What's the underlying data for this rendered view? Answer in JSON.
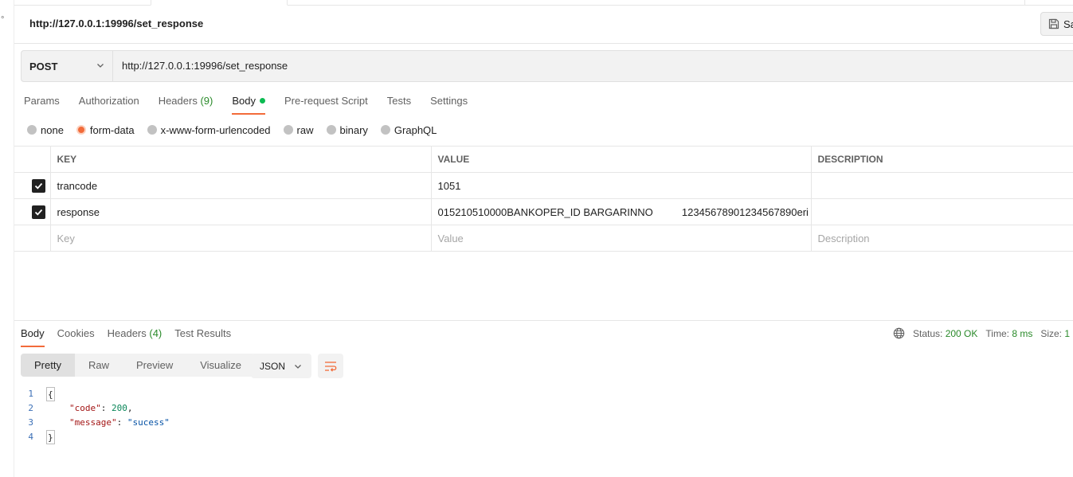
{
  "request": {
    "title": "http://127.0.0.1:19996/set_response",
    "save_label": "Sa",
    "method": "POST",
    "url": "http://127.0.0.1:19996/set_response"
  },
  "request_tabs": [
    {
      "label": "Params"
    },
    {
      "label": "Authorization"
    },
    {
      "label": "Headers",
      "count": "(9)"
    },
    {
      "label": "Body",
      "active": true
    },
    {
      "label": "Pre-request Script"
    },
    {
      "label": "Tests"
    },
    {
      "label": "Settings"
    }
  ],
  "body_types": [
    {
      "label": "none"
    },
    {
      "label": "form-data",
      "selected": true
    },
    {
      "label": "x-www-form-urlencoded"
    },
    {
      "label": "raw"
    },
    {
      "label": "binary"
    },
    {
      "label": "GraphQL"
    }
  ],
  "table": {
    "headers": {
      "key": "KEY",
      "value": "VALUE",
      "description": "DESCRIPTION"
    },
    "rows": [
      {
        "key": "trancode",
        "value": "1051",
        "description": "",
        "checked": true
      },
      {
        "key": "response",
        "value": "015210510000BANKOPER_ID BARGARINNO          12345678901234567890eri",
        "description": "",
        "checked": true
      }
    ],
    "placeholders": {
      "key": "Key",
      "value": "Value",
      "description": "Description"
    }
  },
  "response_tabs": [
    {
      "label": "Body",
      "active": true
    },
    {
      "label": "Cookies"
    },
    {
      "label": "Headers",
      "count": "(4)"
    },
    {
      "label": "Test Results"
    }
  ],
  "response_meta": {
    "status_label": "Status:",
    "status_value": "200 OK",
    "time_label": "Time:",
    "time_value": "8 ms",
    "size_label": "Size:",
    "size_value": "1"
  },
  "view_modes": [
    {
      "label": "Pretty",
      "active": true
    },
    {
      "label": "Raw"
    },
    {
      "label": "Preview"
    },
    {
      "label": "Visualize"
    }
  ],
  "format": "JSON",
  "response_body": {
    "line_numbers": [
      "1",
      "2",
      "3",
      "4"
    ],
    "open_brace": "{",
    "key1": "\"code\"",
    "val1": "200",
    "key2": "\"message\"",
    "val2": "\"sucess\"",
    "close_brace": "}"
  },
  "icons": {
    "save": "save-icon",
    "method_chevron": "chevron-down-icon",
    "globe": "globe-icon",
    "wrap": "wrap-lines-icon",
    "checkbox": "checkmark-icon"
  },
  "colors": {
    "accent": "#f26b3a",
    "success": "#2a8a2a",
    "body_dot": "#0cbb52"
  }
}
